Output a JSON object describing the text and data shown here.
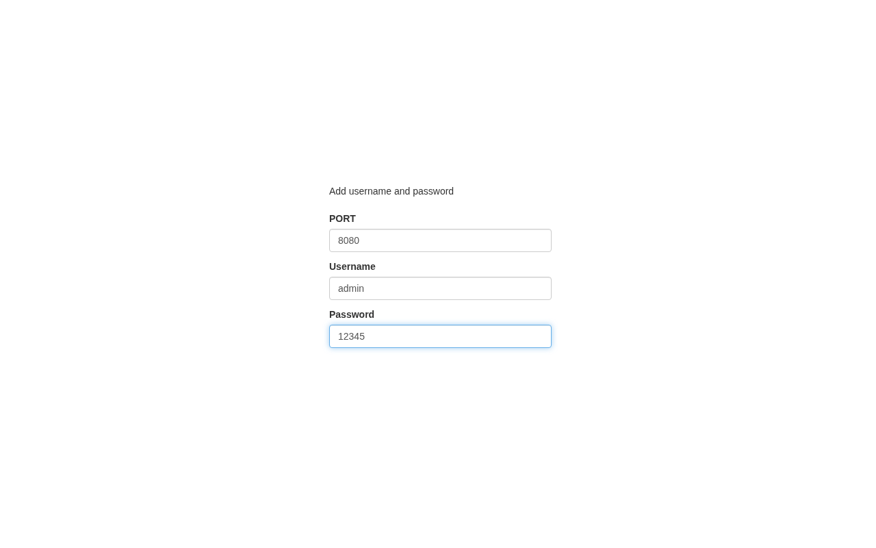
{
  "intro": "Add username and password",
  "fields": [
    {
      "label": "PORT",
      "value": "8080",
      "focused": false
    },
    {
      "label": "Username",
      "value": "admin",
      "focused": false
    },
    {
      "label": "Password",
      "value": "12345",
      "focused": true
    }
  ]
}
